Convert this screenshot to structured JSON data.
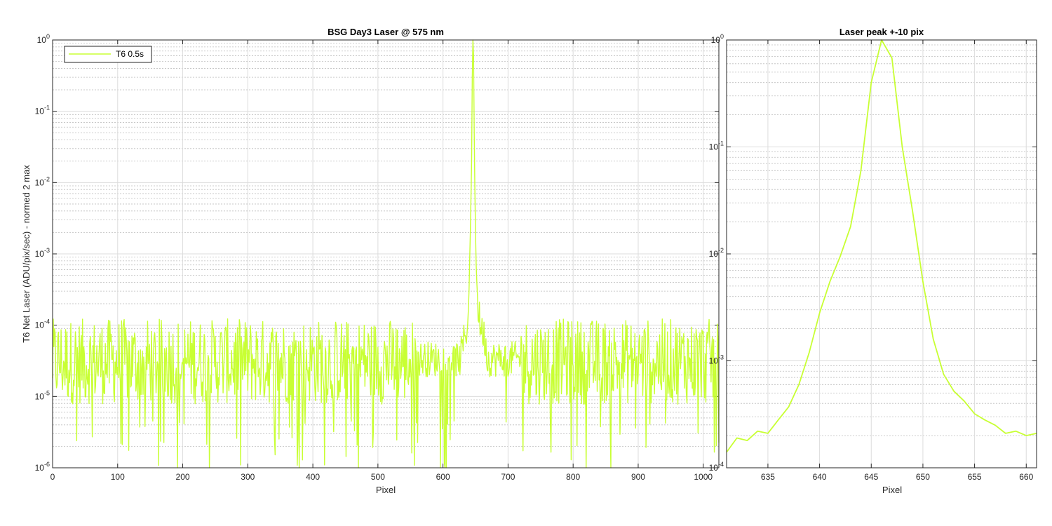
{
  "colors": {
    "series": "#c8ff33",
    "axis": "#262626"
  },
  "chart_data": [
    {
      "type": "line",
      "title": "BSG  Day3 Laser @ 575 nm",
      "xlabel": "Pixel",
      "ylabel": "T6 Net Laser (ADU/pix/sec) - normed 2 max",
      "xlim": [
        0,
        1024
      ],
      "ylim": [
        1e-06,
        1
      ],
      "yscale": "log",
      "grid": true,
      "legend_position": "top-left",
      "legend": [
        "T6 0.5s"
      ],
      "xticks": [
        "0",
        "100",
        "200",
        "300",
        "400",
        "500",
        "600",
        "700",
        "800",
        "900",
        "1000"
      ],
      "ytick_labels": [
        {
          "base": "10",
          "exp": "-6"
        },
        {
          "base": "10",
          "exp": "-5"
        },
        {
          "base": "10",
          "exp": "-4"
        },
        {
          "base": "10",
          "exp": "-3"
        },
        {
          "base": "10",
          "exp": "-2"
        },
        {
          "base": "10",
          "exp": "-1"
        },
        {
          "base": "10",
          "exp": "0"
        }
      ],
      "peak": {
        "x": [
          626,
          630,
          634,
          637,
          639,
          640,
          641,
          642,
          643,
          644,
          645,
          646,
          647,
          648,
          649,
          650,
          651,
          652,
          653,
          655,
          658,
          662,
          666
        ],
        "y": [
          3.5e-05,
          5e-05,
          8e-05,
          0.0001,
          0.00015,
          0.0003,
          0.0008,
          0.002,
          0.006,
          0.02,
          0.3,
          1.0,
          0.6,
          0.05,
          0.008,
          0.002,
          0.0007,
          0.0004,
          0.00025,
          0.00015,
          0.0001,
          8e-05,
          6e-05
        ]
      },
      "series": [
        {
          "name": "T6 0.5s",
          "noise_level_range": [
            2.5e-05,
            6e-05
          ],
          "noise_floor_min": 1e-06
        }
      ]
    },
    {
      "type": "line",
      "title": "Laser peak +-10 pix",
      "xlabel": "Pixel",
      "xlim": [
        631,
        661
      ],
      "ylim": [
        0.0001,
        1
      ],
      "yscale": "log",
      "grid": true,
      "xticks": [
        "635",
        "640",
        "645",
        "650",
        "655",
        "660"
      ],
      "ytick_labels": [
        {
          "base": "10",
          "exp": "-4"
        },
        {
          "base": "10",
          "exp": "-3"
        },
        {
          "base": "10",
          "exp": "-2"
        },
        {
          "base": "10",
          "exp": "-1"
        },
        {
          "base": "10",
          "exp": "0"
        }
      ],
      "series": [
        {
          "x": [
            631,
            632,
            633,
            634,
            635,
            636,
            637,
            638,
            639,
            640,
            641,
            642,
            643,
            644,
            645,
            646,
            647,
            648,
            649,
            650,
            651,
            652,
            653,
            654,
            655,
            656,
            657,
            658,
            659,
            660,
            661
          ],
          "y": [
            0.00014,
            0.00019,
            0.00018,
            0.00022,
            0.00021,
            0.00028,
            0.00037,
            0.0006,
            0.0012,
            0.0028,
            0.0055,
            0.0095,
            0.018,
            0.06,
            0.4,
            1.0,
            0.68,
            0.1,
            0.025,
            0.0055,
            0.0016,
            0.00075,
            0.00052,
            0.00042,
            0.00032,
            0.00028,
            0.00025,
            0.00021,
            0.00022,
            0.0002,
            0.00021
          ]
        }
      ]
    }
  ]
}
